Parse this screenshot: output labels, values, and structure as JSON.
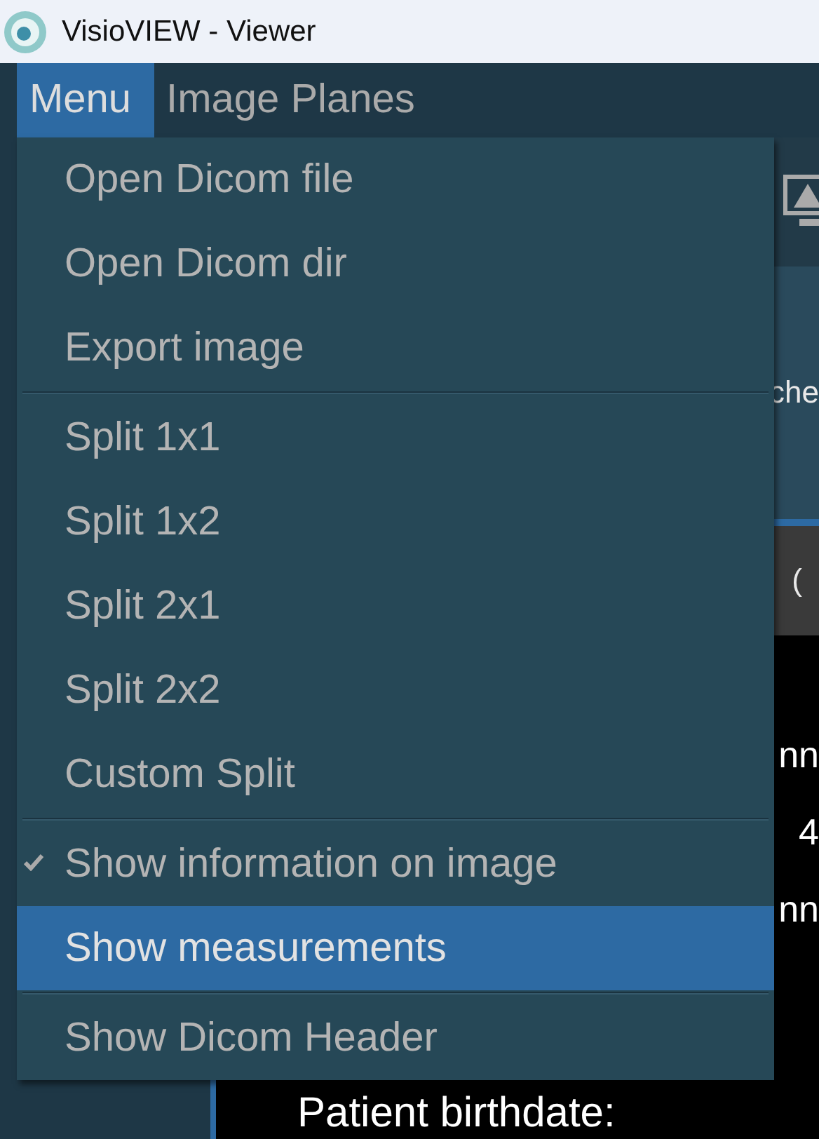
{
  "window": {
    "title": "VisioVIEW - Viewer"
  },
  "menubar": [
    {
      "label": "Menu",
      "selected": true
    },
    {
      "label": "Image Planes",
      "selected": false
    }
  ],
  "menu": {
    "groups": [
      [
        {
          "label": "Open Dicom file",
          "checked": false,
          "selected": false
        },
        {
          "label": "Open Dicom dir",
          "checked": false,
          "selected": false
        },
        {
          "label": "Export image",
          "checked": false,
          "selected": false
        }
      ],
      [
        {
          "label": "Split 1x1",
          "checked": false,
          "selected": false
        },
        {
          "label": "Split 1x2",
          "checked": false,
          "selected": false
        },
        {
          "label": "Split 2x1",
          "checked": false,
          "selected": false
        },
        {
          "label": "Split 2x2",
          "checked": false,
          "selected": false
        },
        {
          "label": "Custom Split",
          "checked": false,
          "selected": false
        }
      ],
      [
        {
          "label": "Show information on image",
          "checked": true,
          "selected": false
        },
        {
          "label": "Show measurements",
          "checked": false,
          "selected": true
        }
      ],
      [
        {
          "label": "Show Dicom Header",
          "checked": false,
          "selected": false
        }
      ]
    ]
  },
  "viewer": {
    "tab_fragment": "che",
    "header_fragment": "(",
    "info_lines": [
      "nn",
      "4",
      "nn",
      "Patient birthdate:"
    ]
  }
}
